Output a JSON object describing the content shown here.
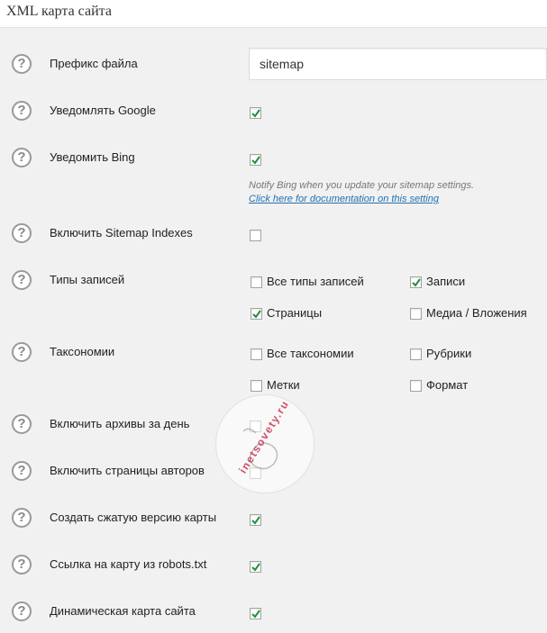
{
  "header": {
    "title": "XML карта сайта"
  },
  "prefix": {
    "label": "Префикс файла",
    "value": "sitemap"
  },
  "google": {
    "label": "Уведомлять Google",
    "checked": true
  },
  "bing": {
    "label": "Уведомить Bing",
    "checked": true,
    "description": "Notify Bing when you update your sitemap settings.",
    "link": "Click here for documentation on this setting"
  },
  "indexes": {
    "label": "Включить Sitemap Indexes",
    "checked": false
  },
  "post_types": {
    "label": "Типы записей",
    "options": [
      {
        "label": "Все типы записей",
        "checked": false
      },
      {
        "label": "Записи",
        "checked": true
      },
      {
        "label": "Страницы",
        "checked": true
      },
      {
        "label": "Медиа / Вложения",
        "checked": false
      }
    ]
  },
  "taxonomies": {
    "label": "Таксономии",
    "options": [
      {
        "label": "Все таксономии",
        "checked": false
      },
      {
        "label": "Рубрики",
        "checked": false
      },
      {
        "label": "Метки",
        "checked": false
      },
      {
        "label": "Формат",
        "checked": false
      }
    ]
  },
  "archives": {
    "label": "Включить архивы за день",
    "checked": false
  },
  "authors": {
    "label": "Включить страницы авторов",
    "checked": false
  },
  "compressed": {
    "label": "Создать сжатую версию карты",
    "checked": true
  },
  "robots": {
    "label": "Ссылка на карту из robots.txt",
    "checked": true
  },
  "dynamic": {
    "label": "Динамическая карта сайта",
    "checked": true
  },
  "help_glyph": "?",
  "watermark": {
    "text": "inetsovety.ru"
  },
  "colors": {
    "check": "#1e8e3e",
    "link": "#2271b1"
  }
}
